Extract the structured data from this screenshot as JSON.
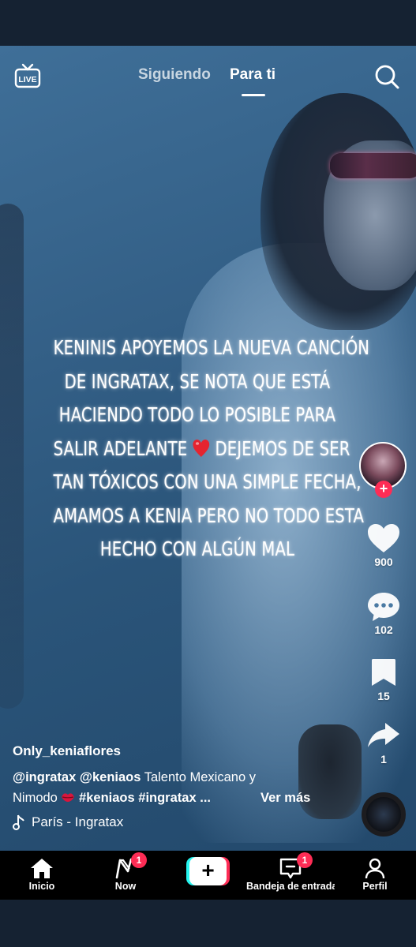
{
  "nav": {
    "live_label": "LIVE",
    "tabs": [
      {
        "label": "Siguiendo",
        "active": false
      },
      {
        "label": "Para ti",
        "active": true
      }
    ]
  },
  "video": {
    "caption_lines": [
      "KENINIS APOYEMOS LA NUEVA CANCIÓN",
      "DE INGRATAX, SE NOTA QUE ESTÁ",
      "HACIENDO TODO LO POSIBLE PARA",
      "SALIR ADELANTE",
      "DEJEMOS DE SER",
      "TAN TÓXICOS CON UNA SIMPLE FECHA,",
      "AMAMOS A KENIA PERO NO TODO ESTA",
      "HECHO CON ALGÚN MAL"
    ],
    "caption_emoji": "red-heart-emoji"
  },
  "actions": {
    "likes": "900",
    "comments": "102",
    "saves": "15",
    "shares": "1"
  },
  "post": {
    "username": "Only_keniaflores",
    "mention1": "@ingratax",
    "mention2": "@keniaos",
    "text1": "Talento Mexicano y",
    "text2": "Nimodo",
    "tag1": "#keniaos",
    "tag2": "#ingratax",
    "ellipsis": "...",
    "see_more": "Ver más",
    "sound": "París - Ingratax"
  },
  "tabbar": {
    "items": [
      {
        "label": "Inicio",
        "icon": "home-icon"
      },
      {
        "label": "Now",
        "icon": "now-icon",
        "badge": "1"
      },
      {
        "label": "",
        "icon": "create-plus-icon"
      },
      {
        "label": "Bandeja de entrada",
        "icon": "inbox-icon",
        "badge": "1"
      },
      {
        "label": "Perfil",
        "icon": "profile-icon"
      }
    ]
  },
  "colors": {
    "accent_red": "#fe2c55",
    "accent_cyan": "#25f4ee",
    "frame": "#152232"
  }
}
